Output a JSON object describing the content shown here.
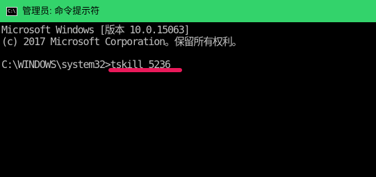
{
  "window": {
    "title": "管理员: 命令提示符",
    "icon": "cmd-icon",
    "icon_text": "C:\\",
    "titlebar_color": "#33d36b"
  },
  "console": {
    "line1": "Microsoft Windows [版本 10.0.15063]",
    "line2": "(c) 2017 Microsoft Corporation。保留所有权利。",
    "prompt": "C:\\WINDOWS\\system32>",
    "command": "tskill 5236",
    "background": "#000000",
    "text_color": "#c0c0c0",
    "highlight_color": "#e9195a"
  }
}
